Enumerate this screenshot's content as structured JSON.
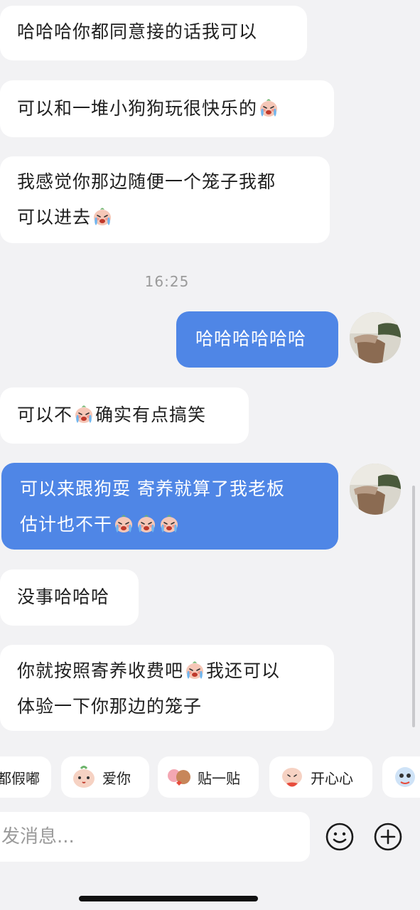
{
  "messages": [
    {
      "from": "them",
      "lines": [
        "哈哈哈你都同意接的话我可以"
      ]
    },
    {
      "from": "them",
      "lines": [
        "可以和一堆小狗狗玩很快乐的"
      ]
    },
    {
      "from": "them",
      "lines": [
        "我感觉你那边随便一个笼子我都",
        "可以进去"
      ]
    },
    {
      "time": "16:25"
    },
    {
      "from": "me",
      "lines": [
        "哈哈哈哈哈哈"
      ]
    },
    {
      "from": "them",
      "lines": [
        "可以不",
        "确实有点搞笑"
      ]
    },
    {
      "from": "me",
      "lines": [
        "可以来跟狗耍 寄养就算了我老板",
        "估计也不干"
      ]
    },
    {
      "from": "them",
      "lines": [
        "没事哈哈哈"
      ]
    },
    {
      "from": "them",
      "lines": [
        "你就按照寄养收费吧",
        "我还可以",
        "体验一下你那边的笼子"
      ]
    }
  ],
  "emoji_name": "crying-face-emoji",
  "sticker_bar": [
    {
      "label": "都假嘟",
      "icon": "sticker-icon"
    },
    {
      "label": "爱你",
      "icon": "love-sticker-icon"
    },
    {
      "label": "贴一贴",
      "icon": "hug-sticker-icon"
    },
    {
      "label": "开心心",
      "icon": "happy-sticker-icon"
    }
  ],
  "input": {
    "placeholder": "发消息..."
  },
  "colors": {
    "outgoing_bubble": "#4f86e6",
    "incoming_bubble": "#ffffff",
    "background": "#f2f2f4"
  }
}
